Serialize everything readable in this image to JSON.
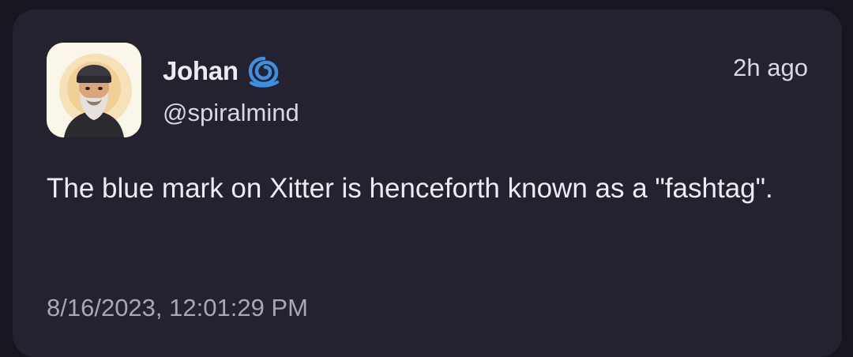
{
  "post": {
    "author": {
      "display_name": "Johan",
      "handle": "@spiralmind",
      "avatar_icon": "bearded-man-avatar",
      "badge_icon": "blue-spiral-badge-icon",
      "badge_color": "#3d8fe0"
    },
    "relative_time": "2h ago",
    "text": "The blue mark on Xitter is henceforth known as a \"fashtag\".",
    "timestamp": "8/16/2023, 12:01:29 PM"
  },
  "colors": {
    "background": "#17161f",
    "card": "#24222f",
    "text_primary": "#ecebf3",
    "text_secondary": "#a9a7b6"
  }
}
